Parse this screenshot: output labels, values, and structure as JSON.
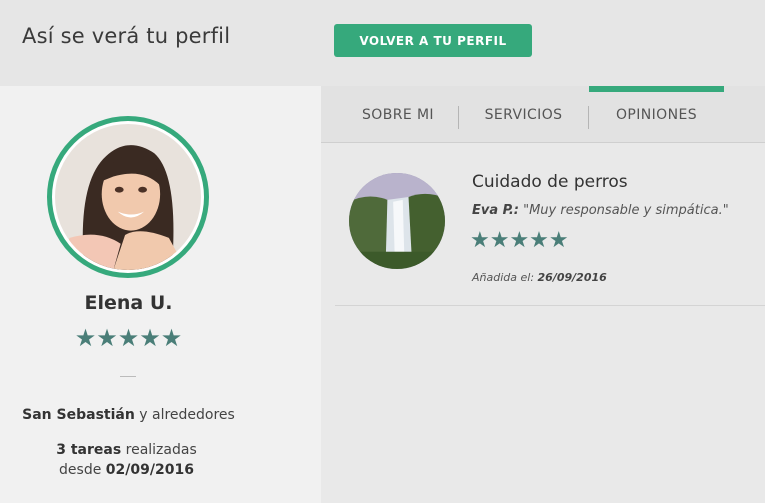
{
  "header": {
    "title": "Así se verá tu perfil",
    "back_button": "VOLVER A TU PERFIL"
  },
  "profile": {
    "name": "Elena U.",
    "stars": "★★★★★",
    "rating": 5,
    "location_bold": "San Sebastián",
    "location_rest": " y alrededores",
    "tasks_bold": "3 tareas",
    "tasks_rest": " realizadas",
    "since_label": "desde ",
    "since_date": "02/09/2016"
  },
  "tabs": [
    {
      "label": "SOBRE MI",
      "active": false
    },
    {
      "label": "SERVICIOS",
      "active": false
    },
    {
      "label": "OPINIONES",
      "active": true
    }
  ],
  "reviews": [
    {
      "service": "Cuidado de perros",
      "author": "Eva P.:",
      "text": " \"Muy responsable y simpática.\"",
      "stars": "★★★★★",
      "rating": 5,
      "added_label": "Añadida el: ",
      "added_date": "26/09/2016"
    }
  ],
  "colors": {
    "accent": "#36a97c",
    "stars": "#4a7e78"
  },
  "icons": {
    "avatar": "avatar-photo",
    "review_thumb": "waterfall-thumbnail"
  }
}
